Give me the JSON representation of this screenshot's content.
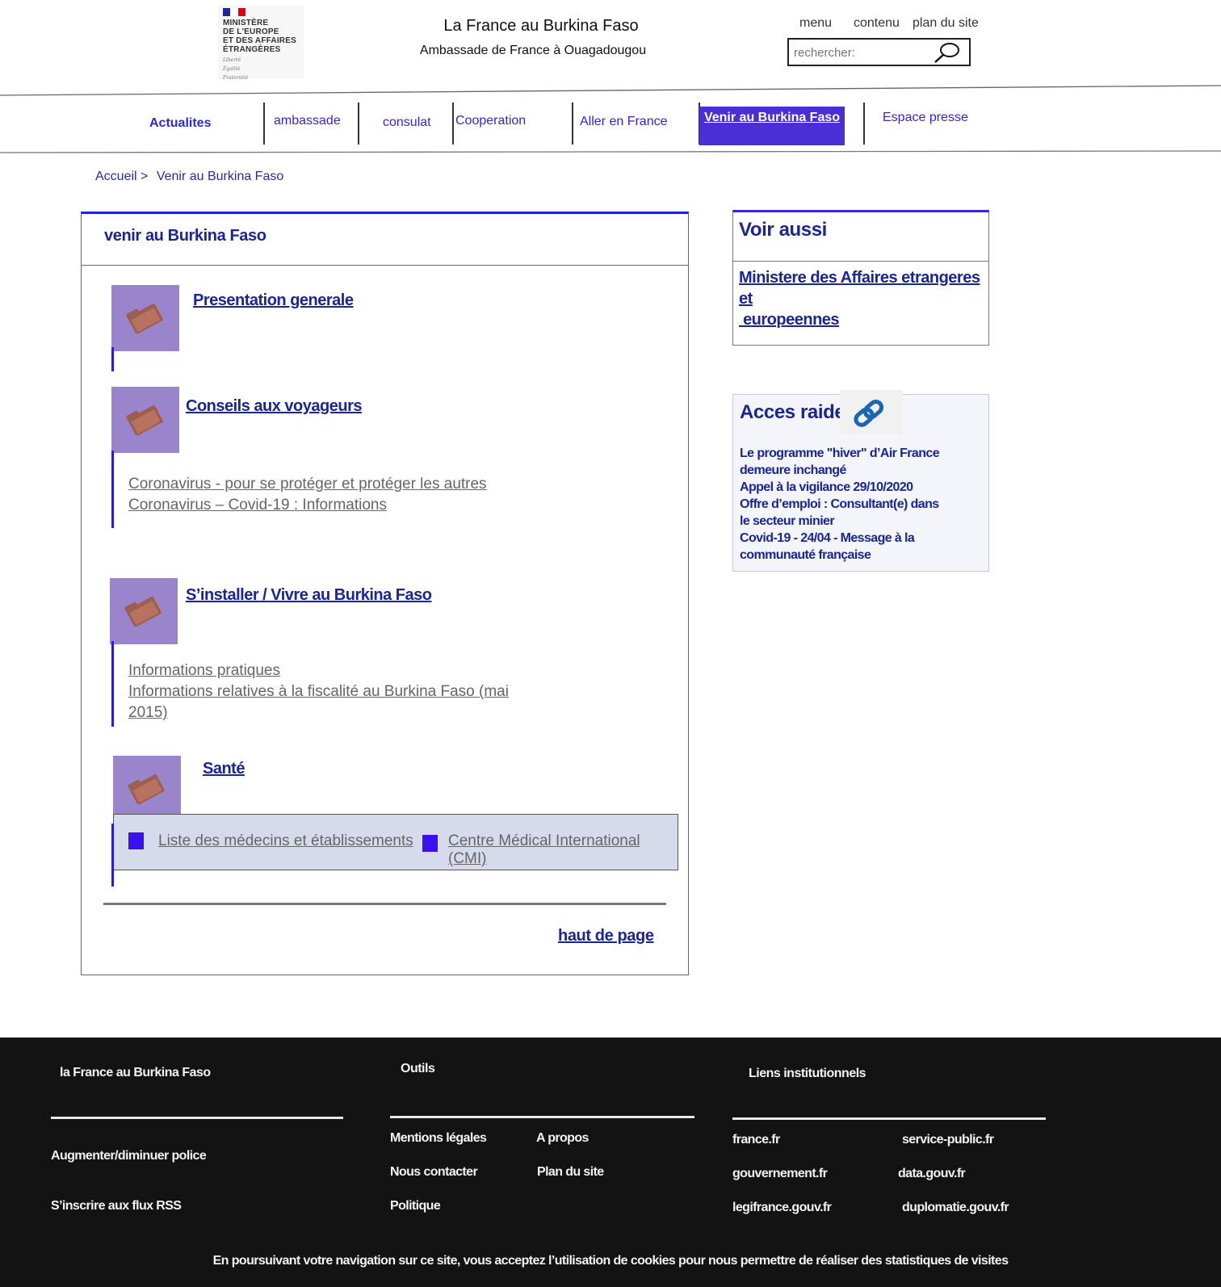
{
  "header": {
    "ministry_lines": [
      "MINISTÈRE",
      "DE L'EUROPE",
      "ET DES AFFAIRES",
      "ÉTRANGÈRES"
    ],
    "ministry_motto": [
      "Liberté",
      "Égalité",
      "Fraternité"
    ],
    "site_title": "La France au Burkina Faso",
    "site_subtitle": "Ambassade de France à Ouagadougou",
    "skip_links": [
      "menu",
      "contenu",
      "plan du site"
    ],
    "search_placeholder": "rechercher:"
  },
  "nav": {
    "items": [
      "Actualites",
      "ambassade",
      "consulat",
      "Cooperation",
      "Aller en France",
      "Venir au Burkina Faso",
      "Espace presse"
    ],
    "active_index": 5
  },
  "breadcrumb": {
    "home": "Accueil",
    "separator": ">",
    "current": "Venir au Burkina  Faso"
  },
  "main": {
    "title": "venir au Burkina Faso",
    "sections": [
      {
        "title": "Presentation generale",
        "links": []
      },
      {
        "title": "Conseils aux voyageurs",
        "links": [
          "Coronavirus - pour se protéger et protéger les autres",
          "Coronavirus – Covid-19 : Informations"
        ]
      },
      {
        "title": "S’installer / Vivre au Burkina Faso",
        "links": [
          "Informations pratiques",
          "Informations relatives à la fiscalité au Burkina Faso (mai",
          "2015)"
        ]
      },
      {
        "title": "Santé",
        "links": [
          "Liste des médecins et établissements",
          "Centre Médical International (CMI)"
        ]
      }
    ],
    "back_to_top": "haut de page"
  },
  "sidebar": {
    "voir_aussi_title": "Voir aussi",
    "voir_aussi_link_lines": [
      "Ministere des Affaires etrangeres et",
      "europeennes"
    ],
    "acces_title": "Acces raide",
    "acces_links": [
      "Le programme \"hiver\" d’Air France",
      "demeure inchangé",
      "Appel à la vigilance 29/10/2020",
      "Offre d’emploi : Consultant(e) dans",
      "le secteur minier",
      "Covid-19 - 24/04 - Message à la",
      "communauté française"
    ]
  },
  "footer": {
    "col1_title": "la France au Burkina Faso",
    "col1_links": [
      "Augmenter/diminuer police",
      "S’inscrire aux flux RSS"
    ],
    "col2_title": "Outils",
    "col2_links": [
      "Mentions légales",
      "A propos",
      "Nous contacter",
      "Plan du site",
      "Politique"
    ],
    "col3_title": "Liens institutionnels",
    "col3_links": [
      "france.fr",
      "service-public.fr",
      "gouvernement.fr",
      "data.gouv.fr",
      "legifrance.gouv.fr",
      "duplomatie.gouv.fr"
    ],
    "cookie_notice": "En poursuivant votre navigation sur ce site, vous acceptez l’utilisation de cookies pour nous permettre de réaliser des statistiques de visites"
  },
  "colors": {
    "accent": "#4a2fd6",
    "link_dark_blue": "#1a2596",
    "folder_tile": "#9a84cc",
    "footer_bg": "#131313"
  },
  "icons": [
    "french-flag-icon",
    "magnifier-icon",
    "folder-icon",
    "chain-link-icon",
    "square-bullet-icon"
  ]
}
